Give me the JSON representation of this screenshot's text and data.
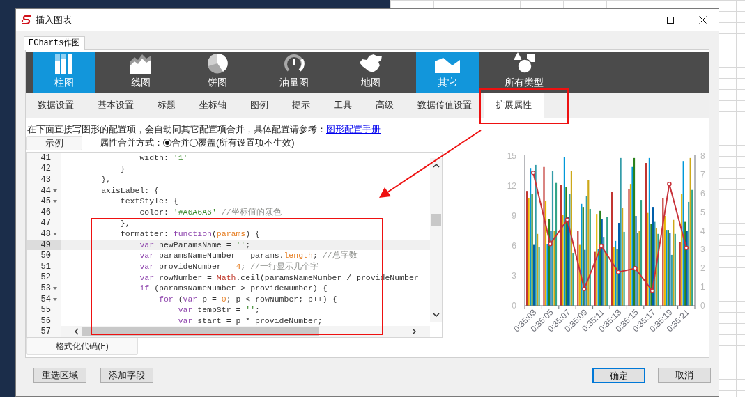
{
  "window": {
    "title": "插入图表",
    "controls": [
      {
        "kind": "minimize",
        "disabled": true
      },
      {
        "kind": "maximize",
        "disabled": false
      },
      {
        "kind": "close",
        "disabled": false
      }
    ]
  },
  "outer_tab": {
    "label": "ECharts作图",
    "selected": true
  },
  "chart_types": [
    {
      "kind": "bar",
      "label": "柱图",
      "selected": true
    },
    {
      "kind": "line",
      "label": "线图",
      "selected": false
    },
    {
      "kind": "pie",
      "label": "饼图",
      "selected": false
    },
    {
      "kind": "gauge",
      "label": "油量图",
      "selected": false
    },
    {
      "kind": "map",
      "label": "地图",
      "selected": false
    },
    {
      "kind": "other",
      "label": "其它",
      "selected": true
    },
    {
      "kind": "all",
      "label": "所有类型",
      "selected": false
    }
  ],
  "tabs": [
    {
      "label": "数据设置",
      "selected": false
    },
    {
      "label": "基本设置",
      "selected": false
    },
    {
      "label": "标题",
      "selected": false
    },
    {
      "label": "坐标轴",
      "selected": false
    },
    {
      "label": "图例",
      "selected": false
    },
    {
      "label": "提示",
      "selected": false
    },
    {
      "label": "工具",
      "selected": false
    },
    {
      "label": "高级",
      "selected": false
    },
    {
      "label": "数据传值设置",
      "selected": false
    },
    {
      "label": "扩展属性",
      "selected": true
    }
  ],
  "description": {
    "text": "在下面直接写图形的配置项，会自动同其它配置项合并，具体配置请参考：",
    "link": "图形配置手册"
  },
  "example_button": "示例",
  "merge_mode": {
    "label": "属性合并方式：",
    "options": [
      {
        "label": "合并",
        "selected": true
      },
      {
        "label": "覆盖(所有设置项不生效)",
        "selected": false
      }
    ]
  },
  "code_lines": [
    {
      "number": "41",
      "foldable": false,
      "selected": false,
      "tokens": [
        {
          "kind": "plain",
          "text": "                width: "
        },
        {
          "kind": "string",
          "text": "'1'"
        }
      ]
    },
    {
      "number": "42",
      "foldable": false,
      "selected": false,
      "tokens": [
        {
          "kind": "plain",
          "text": "            }"
        }
      ]
    },
    {
      "number": "43",
      "foldable": false,
      "selected": false,
      "tokens": [
        {
          "kind": "plain",
          "text": "        },"
        }
      ]
    },
    {
      "number": "44",
      "foldable": true,
      "selected": false,
      "tokens": [
        {
          "kind": "plain",
          "text": "        axisLabel: {"
        }
      ]
    },
    {
      "number": "45",
      "foldable": true,
      "selected": false,
      "tokens": [
        {
          "kind": "plain",
          "text": "            textStyle: {"
        }
      ]
    },
    {
      "number": "46",
      "foldable": false,
      "selected": false,
      "tokens": [
        {
          "kind": "plain",
          "text": "                color: "
        },
        {
          "kind": "string",
          "text": "'#A6A6A6'"
        },
        {
          "kind": "comment",
          "text": " //坐标值的颜色"
        }
      ]
    },
    {
      "number": "47",
      "foldable": false,
      "selected": false,
      "tokens": [
        {
          "kind": "plain",
          "text": "            },"
        }
      ]
    },
    {
      "number": "48",
      "foldable": true,
      "selected": false,
      "tokens": [
        {
          "kind": "plain",
          "text": "            formatter: "
        },
        {
          "kind": "keyword",
          "text": "function"
        },
        {
          "kind": "plain",
          "text": "("
        },
        {
          "kind": "variable",
          "text": "params"
        },
        {
          "kind": "plain",
          "text": ") {"
        }
      ]
    },
    {
      "number": "49",
      "foldable": false,
      "selected": true,
      "tokens": [
        {
          "kind": "keyword",
          "text": "                var"
        },
        {
          "kind": "plain",
          "text": " newParamsName = "
        },
        {
          "kind": "string",
          "text": "''"
        },
        {
          "kind": "plain",
          "text": ";"
        }
      ]
    },
    {
      "number": "50",
      "foldable": false,
      "selected": false,
      "tokens": [
        {
          "kind": "keyword",
          "text": "                var"
        },
        {
          "kind": "plain",
          "text": " paramsNameNumber = params."
        },
        {
          "kind": "variable",
          "text": "length"
        },
        {
          "kind": "plain",
          "text": "; "
        },
        {
          "kind": "comment",
          "text": "//总字数"
        }
      ]
    },
    {
      "number": "51",
      "foldable": false,
      "selected": false,
      "tokens": [
        {
          "kind": "keyword",
          "text": "                var"
        },
        {
          "kind": "plain",
          "text": " provideNumber = "
        },
        {
          "kind": "number",
          "text": "4"
        },
        {
          "kind": "plain",
          "text": "; "
        },
        {
          "kind": "comment",
          "text": "//一行显示几个字"
        }
      ]
    },
    {
      "number": "52",
      "foldable": false,
      "selected": false,
      "tokens": [
        {
          "kind": "keyword",
          "text": "                var"
        },
        {
          "kind": "plain",
          "text": " rowNumber = "
        },
        {
          "kind": "builtin",
          "text": "Math"
        },
        {
          "kind": "plain",
          "text": ".ceil(paramsNameNumber / provideNumber"
        }
      ]
    },
    {
      "number": "53",
      "foldable": true,
      "selected": false,
      "tokens": [
        {
          "kind": "keyword",
          "text": "                if"
        },
        {
          "kind": "plain",
          "text": " (paramsNameNumber > provideNumber) {"
        }
      ]
    },
    {
      "number": "54",
      "foldable": true,
      "selected": false,
      "tokens": [
        {
          "kind": "keyword",
          "text": "                    for"
        },
        {
          "kind": "plain",
          "text": " ("
        },
        {
          "kind": "keyword",
          "text": "var"
        },
        {
          "kind": "plain",
          "text": " p = "
        },
        {
          "kind": "number",
          "text": "0"
        },
        {
          "kind": "plain",
          "text": "; p < rowNumber; p++) {"
        }
      ]
    },
    {
      "number": "55",
      "foldable": false,
      "selected": false,
      "tokens": [
        {
          "kind": "keyword",
          "text": "                        var"
        },
        {
          "kind": "plain",
          "text": " tempStr = "
        },
        {
          "kind": "string",
          "text": "''"
        },
        {
          "kind": "plain",
          "text": ";"
        }
      ]
    },
    {
      "number": "56",
      "foldable": false,
      "selected": false,
      "tokens": [
        {
          "kind": "keyword",
          "text": "                        var"
        },
        {
          "kind": "plain",
          "text": " start = p * provideNumber;"
        }
      ]
    },
    {
      "number": "57",
      "foldable": false,
      "selected": false
    }
  ],
  "format_button": "格式化代码(F)",
  "preview_chart": {
    "chart_data": {
      "type": "bar",
      "categories": [
        "0:35:03",
        "0:35:05",
        "0:35:07",
        "0:35:09",
        "0:35:11",
        "0:35:13",
        "0:35:15",
        "0:35:17",
        "0:35:19",
        "0:35:21"
      ],
      "ylim": [
        0,
        15
      ],
      "yticks": [
        0,
        3,
        6,
        9,
        12,
        15
      ],
      "y2lim": [
        0,
        8
      ],
      "y2ticks": [
        0,
        1,
        2,
        3,
        4,
        5,
        6,
        7,
        8
      ],
      "series": [
        {
          "type": "bar",
          "color": "#c23531",
          "values": [
            11.5,
            13.9,
            12.1,
            7.5,
            5.4,
            11.4,
            11.7,
            14.3,
            10.8,
            6.4
          ]
        },
        {
          "type": "bar",
          "color": "#e6b600",
          "values": [
            10.8,
            10.5,
            9.1,
            6.1,
            9.2,
            5.9,
            12.2,
            9.3,
            9.0,
            11.2
          ]
        },
        {
          "type": "bar",
          "color": "#0098d9",
          "values": [
            13.8,
            6.2,
            14.9,
            10.2,
            5.7,
            6.5,
            13.9,
            14.8,
            7.6,
            14.5
          ]
        },
        {
          "type": "bar",
          "color": "#2b821d",
          "values": [
            11.2,
            8.7,
            11.9,
            9.9,
            9.5,
            5.7,
            14.8,
            8.2,
            7.6,
            8.4
          ]
        },
        {
          "type": "bar",
          "color": "#005eaa",
          "values": [
            6.1,
            7.5,
            8.9,
            5.6,
            8.7,
            8.3,
            9.0,
            9.9,
            7.3,
            7.5
          ]
        },
        {
          "type": "bar",
          "color": "#339ca8",
          "values": [
            14.1,
            13.5,
            11.2,
            11.0,
            6.9,
            14.8,
            7.3,
            8.4,
            5.1,
            10.4
          ]
        },
        {
          "type": "bar",
          "color": "#cda819",
          "values": [
            7.2,
            7.5,
            13.5,
            12.6,
            5.5,
            9.8,
            7.5,
            7.8,
            8.6,
            14.8
          ]
        },
        {
          "type": "bar",
          "color": "#32a487",
          "values": [
            5.9,
            12.3,
            5.3,
            9.7,
            8.9,
            7.4,
            10.6,
            7.2,
            7.2,
            11.6
          ]
        },
        {
          "type": "line",
          "axis": "y2",
          "marker": true,
          "color": "#c8323a",
          "values": [
            7.1,
            3.3,
            4.6,
            0.9,
            3.2,
            1.8,
            2.0,
            0.8,
            6.5,
            3.1
          ]
        }
      ]
    }
  },
  "footer_buttons": [
    {
      "label": "重选区域",
      "focused": false
    },
    {
      "label": "添加字段",
      "focused": false
    },
    {
      "label": "确定",
      "focused": true
    },
    {
      "label": "取消",
      "focused": false
    }
  ]
}
